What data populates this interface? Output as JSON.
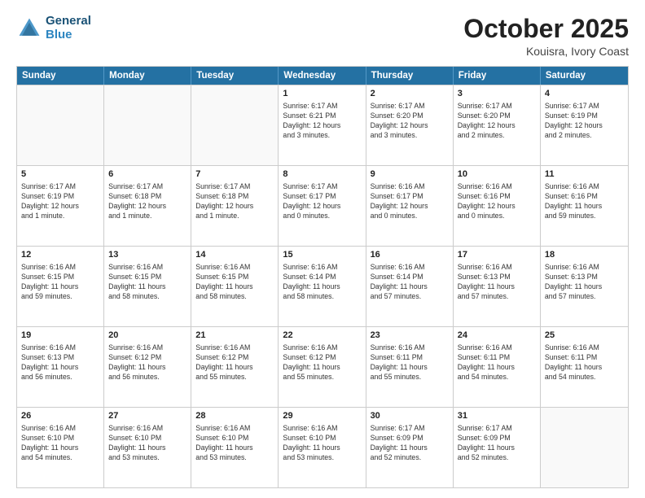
{
  "logo": {
    "line1": "General",
    "line2": "Blue"
  },
  "title": "October 2025",
  "location": "Kouisra, Ivory Coast",
  "days_of_week": [
    "Sunday",
    "Monday",
    "Tuesday",
    "Wednesday",
    "Thursday",
    "Friday",
    "Saturday"
  ],
  "weeks": [
    [
      {
        "day": "",
        "empty": true
      },
      {
        "day": "",
        "empty": true
      },
      {
        "day": "",
        "empty": true
      },
      {
        "day": "1",
        "lines": [
          "Sunrise: 6:17 AM",
          "Sunset: 6:21 PM",
          "Daylight: 12 hours",
          "and 3 minutes."
        ]
      },
      {
        "day": "2",
        "lines": [
          "Sunrise: 6:17 AM",
          "Sunset: 6:20 PM",
          "Daylight: 12 hours",
          "and 3 minutes."
        ]
      },
      {
        "day": "3",
        "lines": [
          "Sunrise: 6:17 AM",
          "Sunset: 6:20 PM",
          "Daylight: 12 hours",
          "and 2 minutes."
        ]
      },
      {
        "day": "4",
        "lines": [
          "Sunrise: 6:17 AM",
          "Sunset: 6:19 PM",
          "Daylight: 12 hours",
          "and 2 minutes."
        ]
      }
    ],
    [
      {
        "day": "5",
        "lines": [
          "Sunrise: 6:17 AM",
          "Sunset: 6:19 PM",
          "Daylight: 12 hours",
          "and 1 minute."
        ]
      },
      {
        "day": "6",
        "lines": [
          "Sunrise: 6:17 AM",
          "Sunset: 6:18 PM",
          "Daylight: 12 hours",
          "and 1 minute."
        ]
      },
      {
        "day": "7",
        "lines": [
          "Sunrise: 6:17 AM",
          "Sunset: 6:18 PM",
          "Daylight: 12 hours",
          "and 1 minute."
        ]
      },
      {
        "day": "8",
        "lines": [
          "Sunrise: 6:17 AM",
          "Sunset: 6:17 PM",
          "Daylight: 12 hours",
          "and 0 minutes."
        ]
      },
      {
        "day": "9",
        "lines": [
          "Sunrise: 6:16 AM",
          "Sunset: 6:17 PM",
          "Daylight: 12 hours",
          "and 0 minutes."
        ]
      },
      {
        "day": "10",
        "lines": [
          "Sunrise: 6:16 AM",
          "Sunset: 6:16 PM",
          "Daylight: 12 hours",
          "and 0 minutes."
        ]
      },
      {
        "day": "11",
        "lines": [
          "Sunrise: 6:16 AM",
          "Sunset: 6:16 PM",
          "Daylight: 11 hours",
          "and 59 minutes."
        ]
      }
    ],
    [
      {
        "day": "12",
        "lines": [
          "Sunrise: 6:16 AM",
          "Sunset: 6:15 PM",
          "Daylight: 11 hours",
          "and 59 minutes."
        ]
      },
      {
        "day": "13",
        "lines": [
          "Sunrise: 6:16 AM",
          "Sunset: 6:15 PM",
          "Daylight: 11 hours",
          "and 58 minutes."
        ]
      },
      {
        "day": "14",
        "lines": [
          "Sunrise: 6:16 AM",
          "Sunset: 6:15 PM",
          "Daylight: 11 hours",
          "and 58 minutes."
        ]
      },
      {
        "day": "15",
        "lines": [
          "Sunrise: 6:16 AM",
          "Sunset: 6:14 PM",
          "Daylight: 11 hours",
          "and 58 minutes."
        ]
      },
      {
        "day": "16",
        "lines": [
          "Sunrise: 6:16 AM",
          "Sunset: 6:14 PM",
          "Daylight: 11 hours",
          "and 57 minutes."
        ]
      },
      {
        "day": "17",
        "lines": [
          "Sunrise: 6:16 AM",
          "Sunset: 6:13 PM",
          "Daylight: 11 hours",
          "and 57 minutes."
        ]
      },
      {
        "day": "18",
        "lines": [
          "Sunrise: 6:16 AM",
          "Sunset: 6:13 PM",
          "Daylight: 11 hours",
          "and 57 minutes."
        ]
      }
    ],
    [
      {
        "day": "19",
        "lines": [
          "Sunrise: 6:16 AM",
          "Sunset: 6:13 PM",
          "Daylight: 11 hours",
          "and 56 minutes."
        ]
      },
      {
        "day": "20",
        "lines": [
          "Sunrise: 6:16 AM",
          "Sunset: 6:12 PM",
          "Daylight: 11 hours",
          "and 56 minutes."
        ]
      },
      {
        "day": "21",
        "lines": [
          "Sunrise: 6:16 AM",
          "Sunset: 6:12 PM",
          "Daylight: 11 hours",
          "and 55 minutes."
        ]
      },
      {
        "day": "22",
        "lines": [
          "Sunrise: 6:16 AM",
          "Sunset: 6:12 PM",
          "Daylight: 11 hours",
          "and 55 minutes."
        ]
      },
      {
        "day": "23",
        "lines": [
          "Sunrise: 6:16 AM",
          "Sunset: 6:11 PM",
          "Daylight: 11 hours",
          "and 55 minutes."
        ]
      },
      {
        "day": "24",
        "lines": [
          "Sunrise: 6:16 AM",
          "Sunset: 6:11 PM",
          "Daylight: 11 hours",
          "and 54 minutes."
        ]
      },
      {
        "day": "25",
        "lines": [
          "Sunrise: 6:16 AM",
          "Sunset: 6:11 PM",
          "Daylight: 11 hours",
          "and 54 minutes."
        ]
      }
    ],
    [
      {
        "day": "26",
        "lines": [
          "Sunrise: 6:16 AM",
          "Sunset: 6:10 PM",
          "Daylight: 11 hours",
          "and 54 minutes."
        ]
      },
      {
        "day": "27",
        "lines": [
          "Sunrise: 6:16 AM",
          "Sunset: 6:10 PM",
          "Daylight: 11 hours",
          "and 53 minutes."
        ]
      },
      {
        "day": "28",
        "lines": [
          "Sunrise: 6:16 AM",
          "Sunset: 6:10 PM",
          "Daylight: 11 hours",
          "and 53 minutes."
        ]
      },
      {
        "day": "29",
        "lines": [
          "Sunrise: 6:16 AM",
          "Sunset: 6:10 PM",
          "Daylight: 11 hours",
          "and 53 minutes."
        ]
      },
      {
        "day": "30",
        "lines": [
          "Sunrise: 6:17 AM",
          "Sunset: 6:09 PM",
          "Daylight: 11 hours",
          "and 52 minutes."
        ]
      },
      {
        "day": "31",
        "lines": [
          "Sunrise: 6:17 AM",
          "Sunset: 6:09 PM",
          "Daylight: 11 hours",
          "and 52 minutes."
        ]
      },
      {
        "day": "",
        "empty": true
      }
    ]
  ]
}
